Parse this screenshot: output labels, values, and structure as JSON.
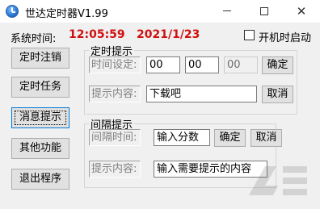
{
  "window": {
    "title": "世达定时器V1.99",
    "icon": "clock-icon"
  },
  "system_time": {
    "label": "系统时间:",
    "time": "12:05:59",
    "date": "2021/1/23",
    "color": "#d01010"
  },
  "startup": {
    "label": "开机时启动",
    "checked": false
  },
  "sidebar": {
    "items": [
      {
        "label": "定时注销"
      },
      {
        "label": "定时任务"
      },
      {
        "label": "消息提示",
        "active": true
      },
      {
        "label": "其他功能"
      },
      {
        "label": "退出程序"
      }
    ]
  },
  "timed_reminder": {
    "group_label": "定时提示",
    "time_label": "时间设定:",
    "hour": "00",
    "minute": "00",
    "second": "00",
    "confirm_label": "确定",
    "content_label": "提示内容:",
    "content": "下载吧",
    "cancel_label": "取消"
  },
  "interval_reminder": {
    "group_label": "间隔提示",
    "interval_label": "间隔时间:",
    "interval_value": "输入分数",
    "confirm_label": "确定",
    "cancel_label": "取消",
    "content_label": "提示内容:",
    "content": "输入需要提示的内容"
  }
}
